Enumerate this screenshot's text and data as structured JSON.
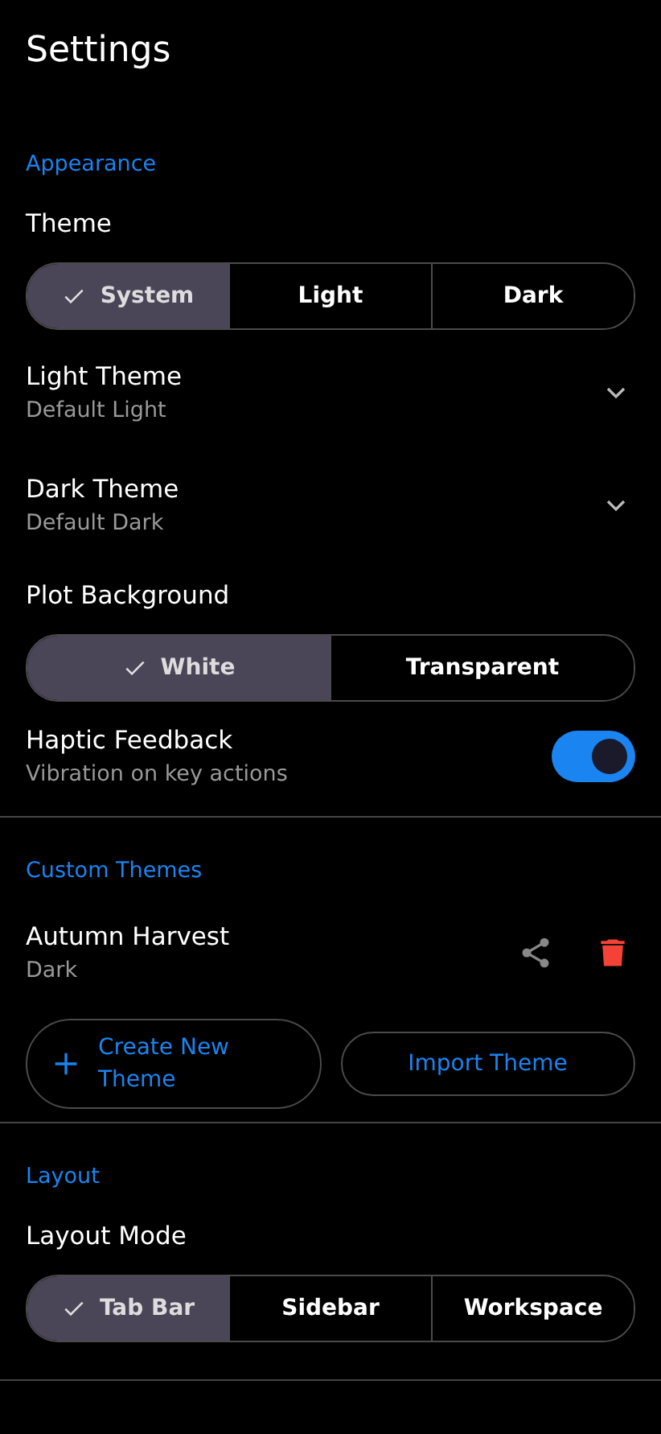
{
  "title": "Settings",
  "sections": [
    {
      "heading": "Appearance",
      "items": [
        {
          "kind": "segmented",
          "label": "Theme",
          "options": [
            {
              "label": "System",
              "selected": true
            },
            {
              "label": "Light",
              "selected": false
            },
            {
              "label": "Dark",
              "selected": false
            }
          ]
        },
        {
          "kind": "dropdown",
          "label": "Light Theme",
          "value": "Default Light"
        },
        {
          "kind": "dropdown",
          "label": "Dark Theme",
          "value": "Default Dark"
        },
        {
          "kind": "segmented",
          "label": "Plot Background",
          "options": [
            {
              "label": "White",
              "selected": true
            },
            {
              "label": "Transparent",
              "selected": false
            }
          ]
        },
        {
          "kind": "toggle",
          "label": "Haptic Feedback",
          "subtitle": "Vibration on key actions",
          "on": true
        }
      ]
    },
    {
      "heading": "Custom Themes",
      "items": [
        {
          "kind": "theme",
          "label": "Autumn Harvest",
          "subtitle": "Dark"
        },
        {
          "kind": "actions",
          "buttons": [
            {
              "kind": "create",
              "label": "Create New Theme"
            },
            {
              "kind": "import",
              "label": "Import Theme"
            }
          ]
        }
      ]
    },
    {
      "heading": "Layout",
      "items": [
        {
          "kind": "segmented",
          "label": "Layout Mode",
          "options": [
            {
              "label": "Tab Bar",
              "selected": true
            },
            {
              "label": "Sidebar",
              "selected": false
            },
            {
              "label": "Workspace",
              "selected": false
            }
          ]
        }
      ]
    }
  ]
}
